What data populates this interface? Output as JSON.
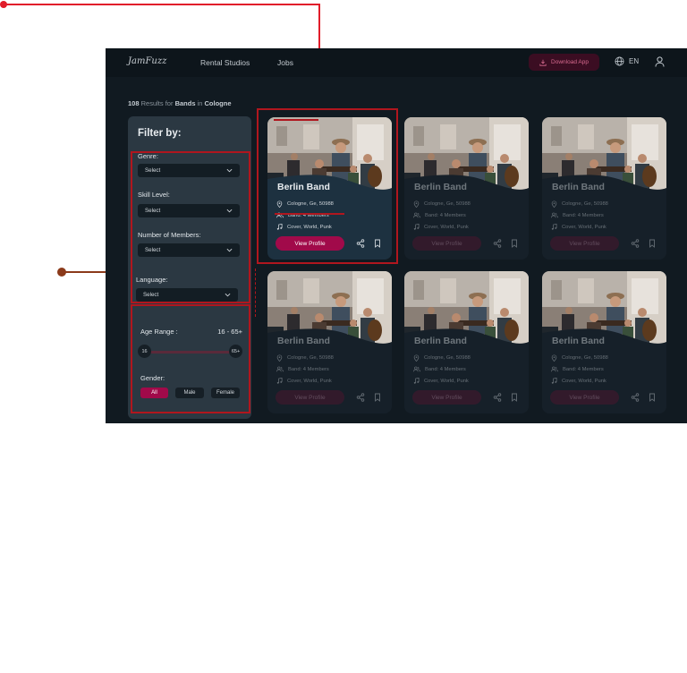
{
  "app": {
    "logo_text": "JamFuzz",
    "nav": [
      "Rental Studios",
      "Jobs"
    ],
    "download_label": "Download App",
    "language": "EN",
    "accent_color": "#a10a4a"
  },
  "results": {
    "count": "108",
    "prefix": "Results for",
    "term": "Bands",
    "in_word": "in",
    "city": "Cologne"
  },
  "filter": {
    "title": "Filter by:",
    "genre_label": "Genre:",
    "skill_label": "Skill Level:",
    "members_label": "Number of Members:",
    "language_label": "Language:",
    "select_placeholder": "Select",
    "age_label": "Age Range :",
    "age_value": "16 - 65+",
    "age_min": "16",
    "age_max": "65+",
    "gender_label": "Gender:",
    "gender_options": [
      "All",
      "Male",
      "Female"
    ],
    "gender_selected": "All"
  },
  "cards": [
    {
      "name": "Berlin Band",
      "location": "Cologne, Ge, 50988",
      "members": "Band: 4 Members",
      "genres": "Cover, World, Punk",
      "cta": "View Profile"
    },
    {
      "name": "Berlin Band",
      "location": "Cologne, Ge, 50988",
      "members": "Band: 4 Members",
      "genres": "Cover, World, Punk",
      "cta": "View Profile"
    },
    {
      "name": "Berlin Band",
      "location": "Cologne, Ge, 50988",
      "members": "Band: 4 Members",
      "genres": "Cover, World, Punk",
      "cta": "View Profile"
    },
    {
      "name": "Berlin Band",
      "location": "Cologne, Ge, 50988",
      "members": "Band: 4 Members",
      "genres": "Cover, World, Punk",
      "cta": "View Profile"
    },
    {
      "name": "Berlin Band",
      "location": "Cologne, Ge, 50988",
      "members": "Band: 4 Members",
      "genres": "Cover, World, Punk",
      "cta": "View Profile"
    },
    {
      "name": "Berlin Band",
      "location": "Cologne, Ge, 50988",
      "members": "Band: 4 Members",
      "genres": "Cover, World, Punk",
      "cta": "View Profile"
    }
  ]
}
